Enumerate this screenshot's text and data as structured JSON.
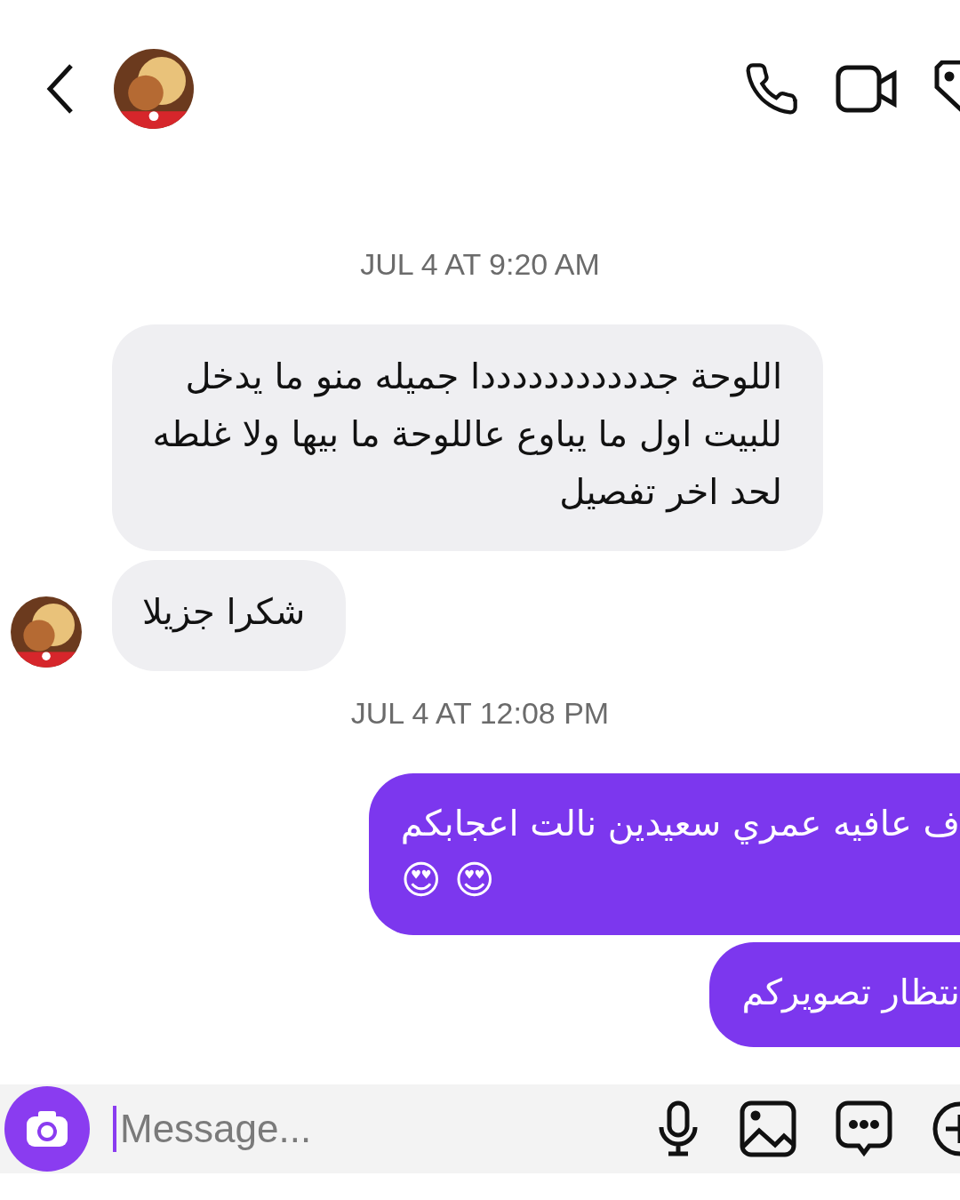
{
  "messages": [
    {
      "kind": "timestamp",
      "text": "JUL 4 AT 9:20 AM"
    },
    {
      "kind": "incoming",
      "text": "اللوحة جدددددددددددا جميله منو ما يدخل للبيت اول ما يباوع عاللوحة ما بيها ولا غلطه لحد اخر تفصيل",
      "show_avatar": false
    },
    {
      "kind": "incoming",
      "text": "شكرا جزيلا",
      "show_avatar": true
    },
    {
      "kind": "timestamp",
      "text": "JUL 4 AT 12:08 PM"
    },
    {
      "kind": "outgoing",
      "text": "ف عافيه عمري سعيدين نالت اعجابكم",
      "emoji": "😍 😍"
    },
    {
      "kind": "outgoing",
      "text": "نتظار تصويركم"
    }
  ],
  "composer": {
    "placeholder": "Message..."
  }
}
